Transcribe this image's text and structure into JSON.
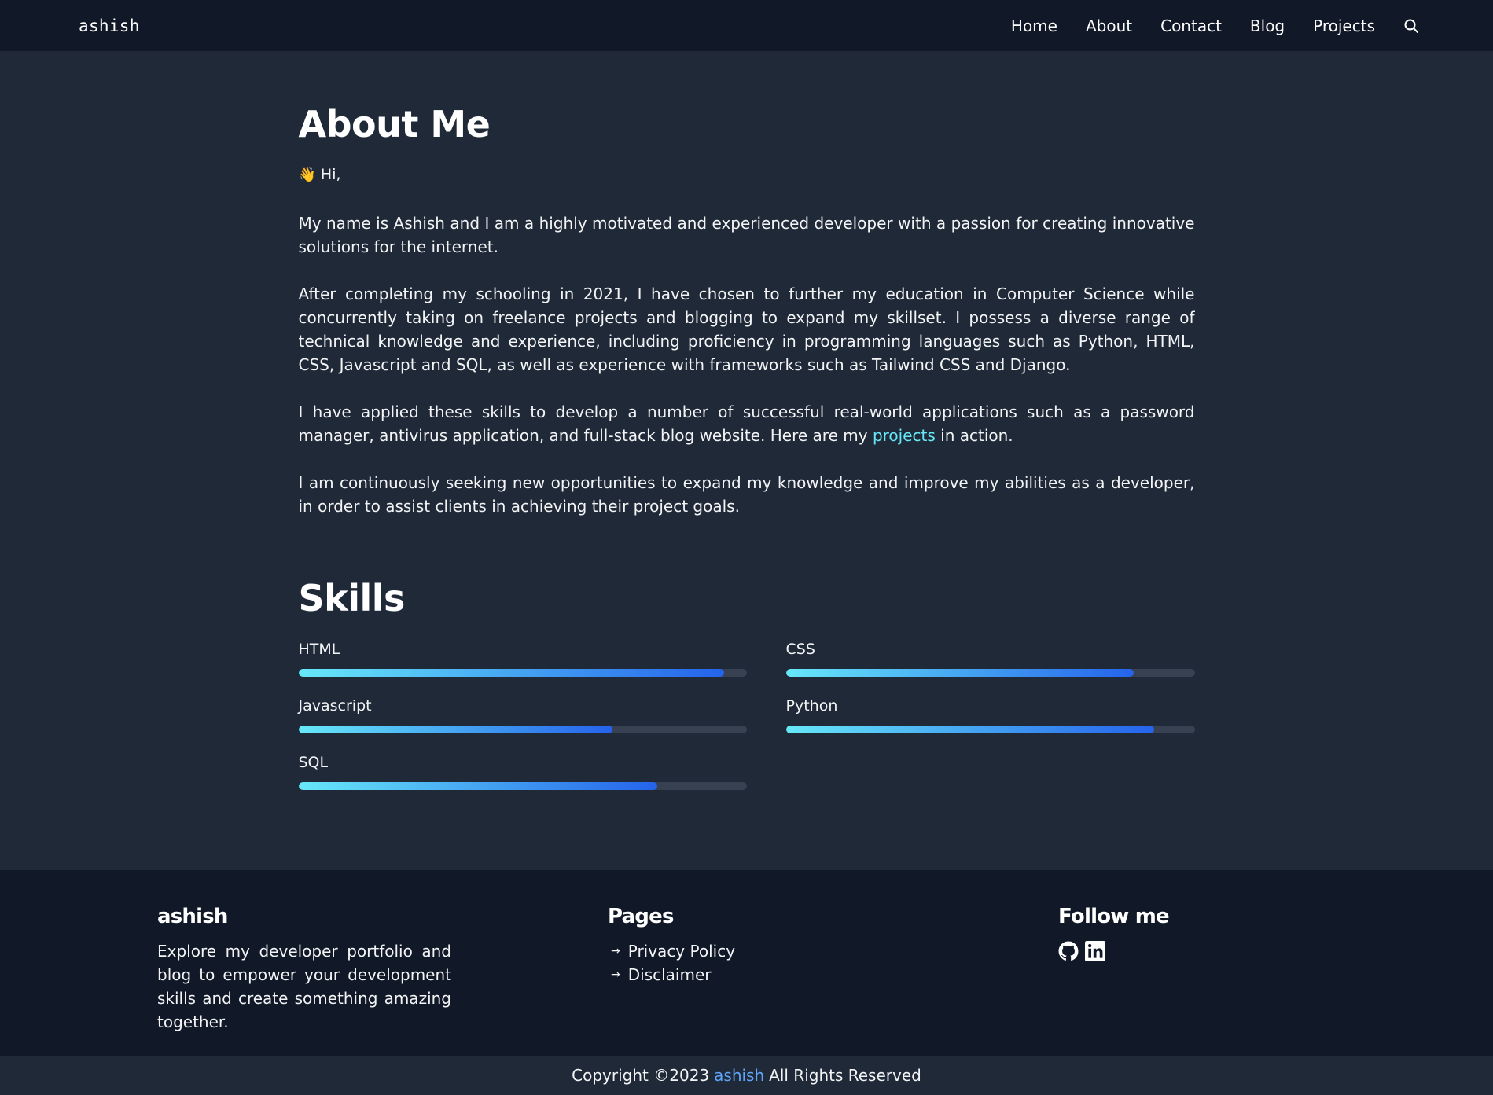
{
  "header": {
    "brand": "ashish",
    "nav": [
      "Home",
      "About",
      "Contact",
      "Blog",
      "Projects"
    ],
    "search_icon": "search-icon"
  },
  "about": {
    "title": "About Me",
    "greeting_emoji": "👋",
    "greeting": "Hi,",
    "p1": "My name is Ashish and I am a highly motivated and experienced developer with a passion for creating innovative solutions for the internet.",
    "p2": "After completing my schooling in 2021, I have chosen to further my education in Computer Science while concurrently taking on freelance projects and blogging to expand my skillset. I possess a diverse range of technical knowledge and experience, including proficiency in programming languages such as Python, HTML, CSS, Javascript and SQL, as well as experience with frameworks such as Tailwind CSS and Django.",
    "p3_before": "I have applied these skills to develop a number of successful real-world applications such as a password manager, antivirus application, and full-stack blog website. Here are my ",
    "p3_link": "projects",
    "p3_after": " in action.",
    "p4": "I am continuously seeking new opportunities to expand my knowledge and improve my abilities as a developer, in order to assist clients in achieving their project goals."
  },
  "skills": {
    "title": "Skills",
    "items": [
      {
        "name": "HTML",
        "level": 95
      },
      {
        "name": "CSS",
        "level": 85
      },
      {
        "name": "Javascript",
        "level": 70
      },
      {
        "name": "Python",
        "level": 90
      },
      {
        "name": "SQL",
        "level": 80
      }
    ]
  },
  "footer": {
    "brand": "ashish",
    "description": "Explore my developer portfolio and blog to empower your development skills and create something amazing together.",
    "pages_title": "Pages",
    "pages": [
      "Privacy Policy",
      "Disclaimer"
    ],
    "follow_title": "Follow me",
    "social_icons": [
      "github-icon",
      "linkedin-icon"
    ]
  },
  "copyright": {
    "before": "Copyright ©2023",
    "name": "ashish",
    "after": "All Rights Reserved"
  },
  "colors": {
    "header_bg": "#111827",
    "page_bg": "#1f2937",
    "accent": "#67e8f9",
    "link_blue": "#60a5fa",
    "bar_start": "#67e8f9",
    "bar_end": "#2563eb"
  }
}
